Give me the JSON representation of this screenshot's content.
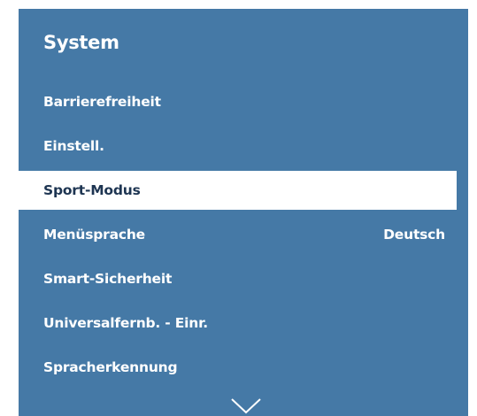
{
  "panel": {
    "title": "System"
  },
  "menu": {
    "items": [
      {
        "label": "Barrierefreiheit",
        "value": "",
        "selected": false
      },
      {
        "label": "Einstell.",
        "value": "",
        "selected": false
      },
      {
        "label": "Sport-Modus",
        "value": "",
        "selected": true
      },
      {
        "label": "Menüsprache",
        "value": "Deutsch",
        "selected": false
      },
      {
        "label": "Smart-Sicherheit",
        "value": "",
        "selected": false
      },
      {
        "label": "Universalfernb. - Einr.",
        "value": "",
        "selected": false
      },
      {
        "label": "Spracherkennung",
        "value": "",
        "selected": false
      }
    ]
  },
  "icons": {
    "scroll_down": "chevron-down-icon"
  },
  "colors": {
    "panel_bg": "#4579a6",
    "selected_bg": "#ffffff",
    "selected_text": "#1e3552",
    "text": "#ffffff"
  }
}
